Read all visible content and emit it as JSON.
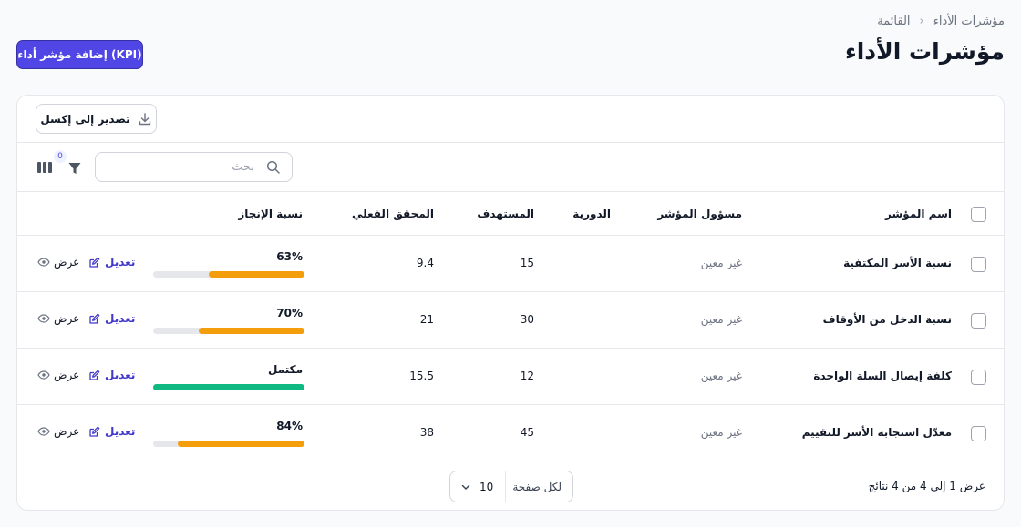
{
  "breadcrumb": {
    "parent": "مؤشرات الأداء",
    "current": "القائمة"
  },
  "page_title": "مؤشرات الأداء",
  "add_button": "إضافة مؤشر أداء (KPI)",
  "export_button": "تصدير إلى إكسل",
  "search": {
    "placeholder": "بحث",
    "value": ""
  },
  "filter_count": "0",
  "columns": {
    "name": "اسم المؤشر",
    "owner": "مسؤول المؤشر",
    "period": "الدورية",
    "target": "المستهدف",
    "actual": "المحقق الفعلي",
    "achievement": "نسبة الإنجاز"
  },
  "rows": [
    {
      "name": "نسبة الأسر المكتفية",
      "owner": "غير معين",
      "period": "",
      "target": "15",
      "actual": "9.4",
      "achievement_label": "63%",
      "achievement": 0.63,
      "bar_color": "#f59e0b",
      "edit": "تعديل",
      "view": "عرض"
    },
    {
      "name": "نسبة الدخل من الأوقاف",
      "owner": "غير معين",
      "period": "",
      "target": "30",
      "actual": "21",
      "achievement_label": "70%",
      "achievement": 0.7,
      "bar_color": "#f59e0b",
      "edit": "تعديل",
      "view": "عرض"
    },
    {
      "name": "كلفة إيصال السلة الواحدة",
      "owner": "غير معين",
      "period": "",
      "target": "12",
      "actual": "15.5",
      "achievement_label": "مكتمل",
      "achievement": 1.0,
      "bar_color": "#10b981",
      "edit": "تعديل",
      "view": "عرض"
    },
    {
      "name": "معدّل استجابة الأسر للتقييم",
      "owner": "غير معين",
      "period": "",
      "target": "45",
      "actual": "38",
      "achievement_label": "84%",
      "achievement": 0.84,
      "bar_color": "#f59e0b",
      "edit": "تعديل",
      "view": "عرض"
    }
  ],
  "footer": {
    "results_text": "عرض 1 إلى 4 من 4 نتائج",
    "per_page_label": "لكل صفحة",
    "per_page_value": "10"
  },
  "colors": {
    "accent": "#4f46e5",
    "progress_partial": "#f59e0b",
    "progress_complete": "#10b981"
  },
  "icons": [
    "chevron-right-icon",
    "download-icon",
    "search-icon",
    "filter-icon",
    "columns-icon",
    "edit-icon",
    "eye-icon",
    "chevron-down-icon"
  ]
}
